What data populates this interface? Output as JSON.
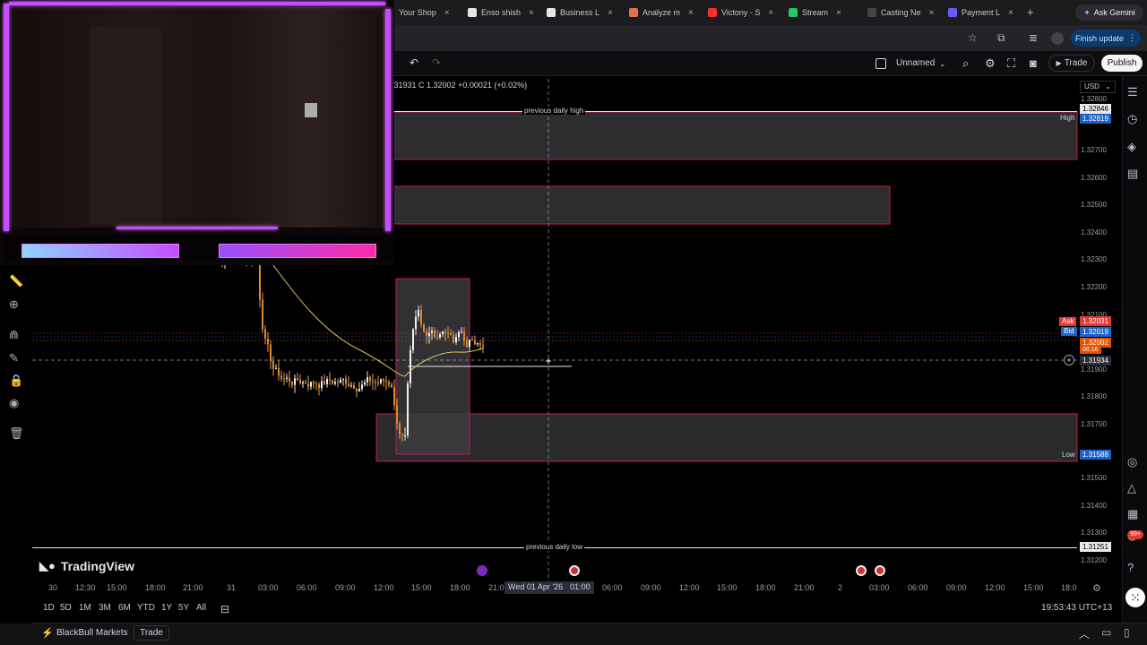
{
  "browser": {
    "tabs": [
      {
        "label": "Your Shop",
        "color": "#f1a23a"
      },
      {
        "label": "Enso shish",
        "color": "#e6e6e6"
      },
      {
        "label": "Business L",
        "color": "#e6e6e6"
      },
      {
        "label": "Analyze m",
        "color": "#e0734d"
      },
      {
        "label": "Victony - S",
        "color": "#ff2d2d"
      },
      {
        "label": "Stream",
        "color": "#29c36a"
      },
      {
        "label": "Casting Ne",
        "color": "#444444"
      },
      {
        "label": "Payment L",
        "color": "#6b5bff"
      }
    ],
    "new_tab": "+",
    "gemini": "Ask Gemini",
    "finish_update": "Finish update"
  },
  "toolbar": {
    "layout_name": "Unnamed",
    "trade": "Trade",
    "publish": "Publish"
  },
  "legend": {
    "ohlc_text": "1.31931 C 1.32002 +0.00021 (+0.02%)"
  },
  "currency": "USD",
  "price_scale": {
    "labels": [
      "1.32800",
      "1.32700",
      "1.32600",
      "1.32500",
      "1.32400",
      "1.32300",
      "1.32200",
      "1.32100",
      "1.31900",
      "1.31800",
      "1.31700",
      "1.31500",
      "1.31400",
      "1.31300",
      "1.31200"
    ],
    "high_tag": "High",
    "high_value": "1.32819",
    "prev_high_value": "1.32846",
    "ask_tag": "Ask",
    "ask_value": "1.32031",
    "bid_tag": "Bid",
    "bid_value": "1.32019",
    "last_value": "1.32002",
    "countdown": "06:16",
    "cursor_value": "1.31934",
    "low_tag": "Low",
    "low_value": "1.31588",
    "prev_low_value": "1.31251"
  },
  "chart_labels": {
    "previous_daily_high": "previous daily high",
    "previous_daily_low": "previous daily low"
  },
  "time_axis": [
    "30",
    "12:30",
    "15:00",
    "18:00",
    "21:00",
    "31",
    "03:00",
    "06:00",
    "09:00",
    "12:00",
    "15:00",
    "18:00",
    "21:0",
    "06:00",
    "09:00",
    "12:00",
    "15:00",
    "18:00",
    "21:00",
    "2",
    "03:00",
    "06:00",
    "09:00",
    "12:00",
    "15:00",
    "18:0"
  ],
  "crosshair_time": "Wed 01 Apr '26",
  "crosshair_time2": "01:00",
  "brand": "TradingView",
  "timeframes": [
    "1D",
    "5D",
    "1M",
    "3M",
    "6M",
    "YTD",
    "1Y",
    "5Y",
    "All"
  ],
  "clock": "19:53:43 UTC+13",
  "bottom": {
    "broker": "BlackBull Markets",
    "trade": "Trade"
  },
  "notification_badge": "99+",
  "colors": {
    "zone_border": "#c2185b",
    "zone_fill": "#3a3a3a",
    "ask": "#e53935",
    "bid": "#1e63c9",
    "last": "#e65100",
    "ma_line": "#d8c45a",
    "webcam_frame": "#c44dff"
  },
  "chart_data": {
    "type": "candlestick",
    "symbol_hint": "forex pair",
    "ohlc_close": 1.32002,
    "change": 0.00021,
    "change_pct": 0.02,
    "y_range": [
      1.3115,
      1.3288
    ],
    "zones": [
      {
        "name": "previous daily high zone",
        "from": 1.32846,
        "to": 1.3266
      },
      {
        "name": "upper supply zone",
        "from": 1.3257,
        "to": 1.3244
      },
      {
        "name": "lower demand zone",
        "from": 1.3178,
        "to": 1.3156
      },
      {
        "name": "session box",
        "from": 1.32255,
        "to": 1.31588
      }
    ],
    "levels": {
      "previous_daily_high": 1.32846,
      "previous_daily_low": 1.31251,
      "high": 1.32819,
      "low": 1.31588,
      "ask": 1.32031,
      "bid": 1.32019,
      "last": 1.32002
    }
  }
}
